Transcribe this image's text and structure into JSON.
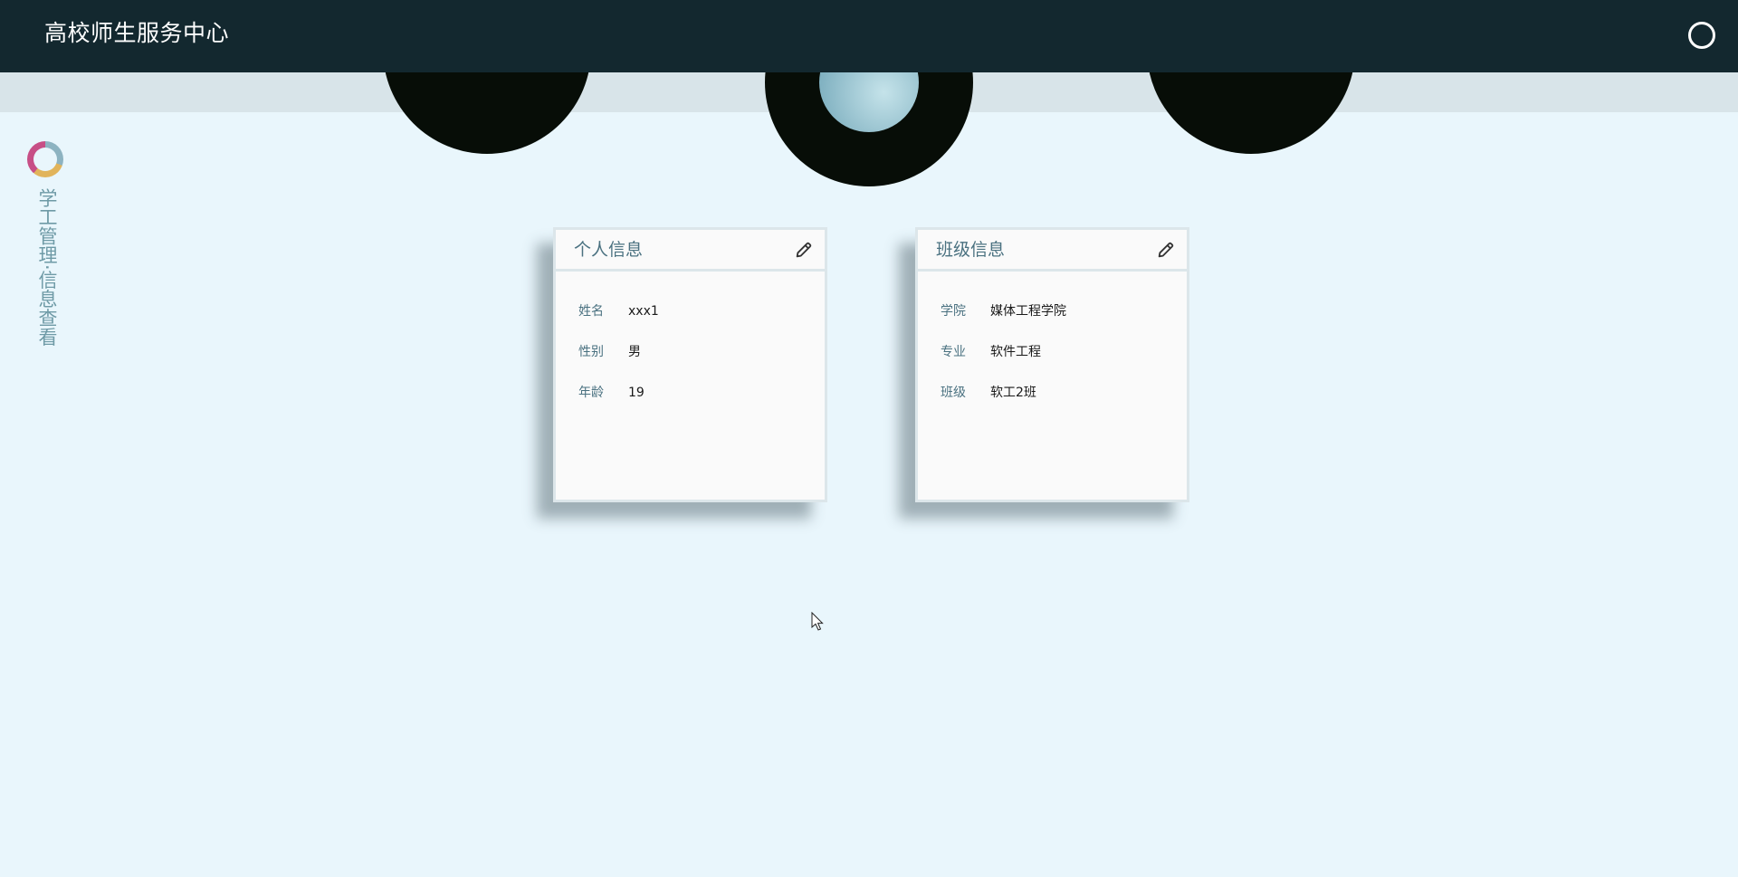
{
  "header": {
    "title": "高校师生服务中心",
    "chat_icon": "chat-bubble-icon"
  },
  "sidebar": {
    "logo_icon": "ring-logo-icon",
    "title": "学工管理·信息查看"
  },
  "cards": [
    {
      "title": "个人信息",
      "edit_icon": "pencil-icon",
      "rows": [
        {
          "label": "姓名",
          "value": "xxx1"
        },
        {
          "label": "性别",
          "value": "男"
        },
        {
          "label": "年龄",
          "value": "19"
        }
      ]
    },
    {
      "title": "班级信息",
      "edit_icon": "pencil-icon",
      "rows": [
        {
          "label": "学院",
          "value": "媒体工程学院"
        },
        {
          "label": "专业",
          "value": "软件工程"
        },
        {
          "label": "班级",
          "value": "软工2班"
        }
      ]
    }
  ],
  "colors": {
    "topbar": "#13282f",
    "background": "#e9f6fc",
    "accent_text": "#4a7180",
    "disc_dots": [
      "#d99a48",
      "#a4cdd8",
      "#d9588f"
    ]
  }
}
